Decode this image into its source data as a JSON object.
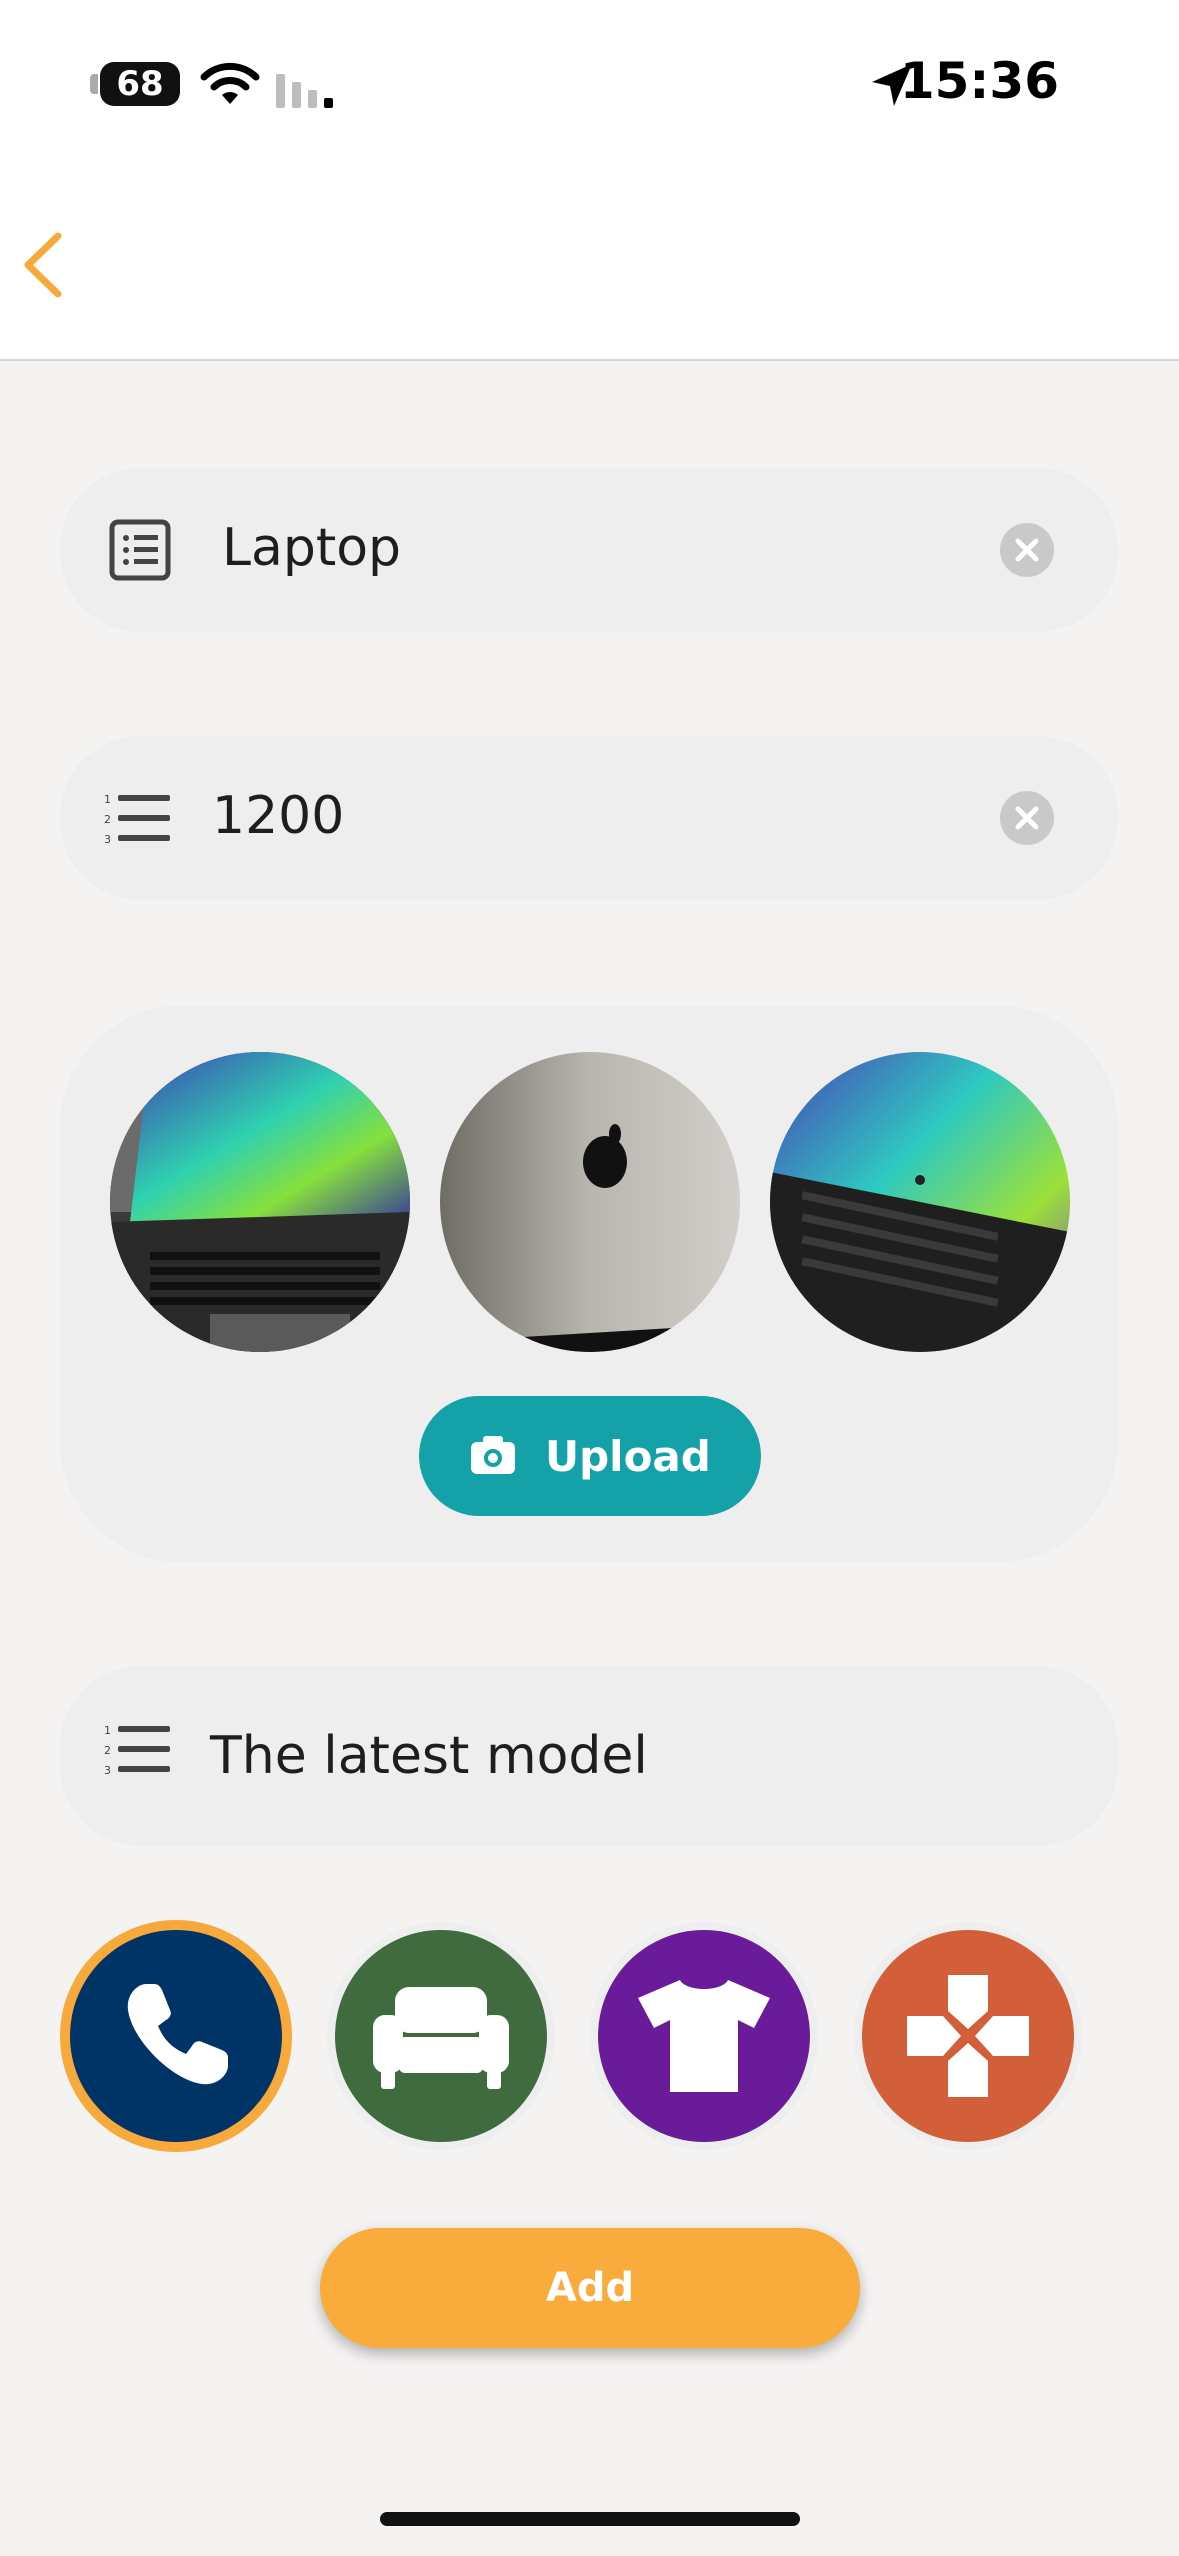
{
  "status_bar": {
    "battery": "68",
    "time": "15:36"
  },
  "nav": {
    "back_icon": "chevron-left-icon"
  },
  "form": {
    "name_value": "Laptop",
    "price_value": "1200",
    "description_value": "The latest model"
  },
  "photos": {
    "upload_label": "Upload",
    "count": 3
  },
  "categories": [
    {
      "icon": "phone-icon",
      "color": "#003366",
      "selected": true
    },
    {
      "icon": "sofa-icon",
      "color": "#3f6b3f",
      "selected": false
    },
    {
      "icon": "tshirt-icon",
      "color": "#6a1b9a",
      "selected": false
    },
    {
      "icon": "gamepad-icon",
      "color": "#d35f3a",
      "selected": false
    }
  ],
  "add_label": "Add",
  "colors": {
    "accent": "#f9ab3c",
    "teal": "#14a1a8",
    "field_bg": "#eeeeee"
  }
}
